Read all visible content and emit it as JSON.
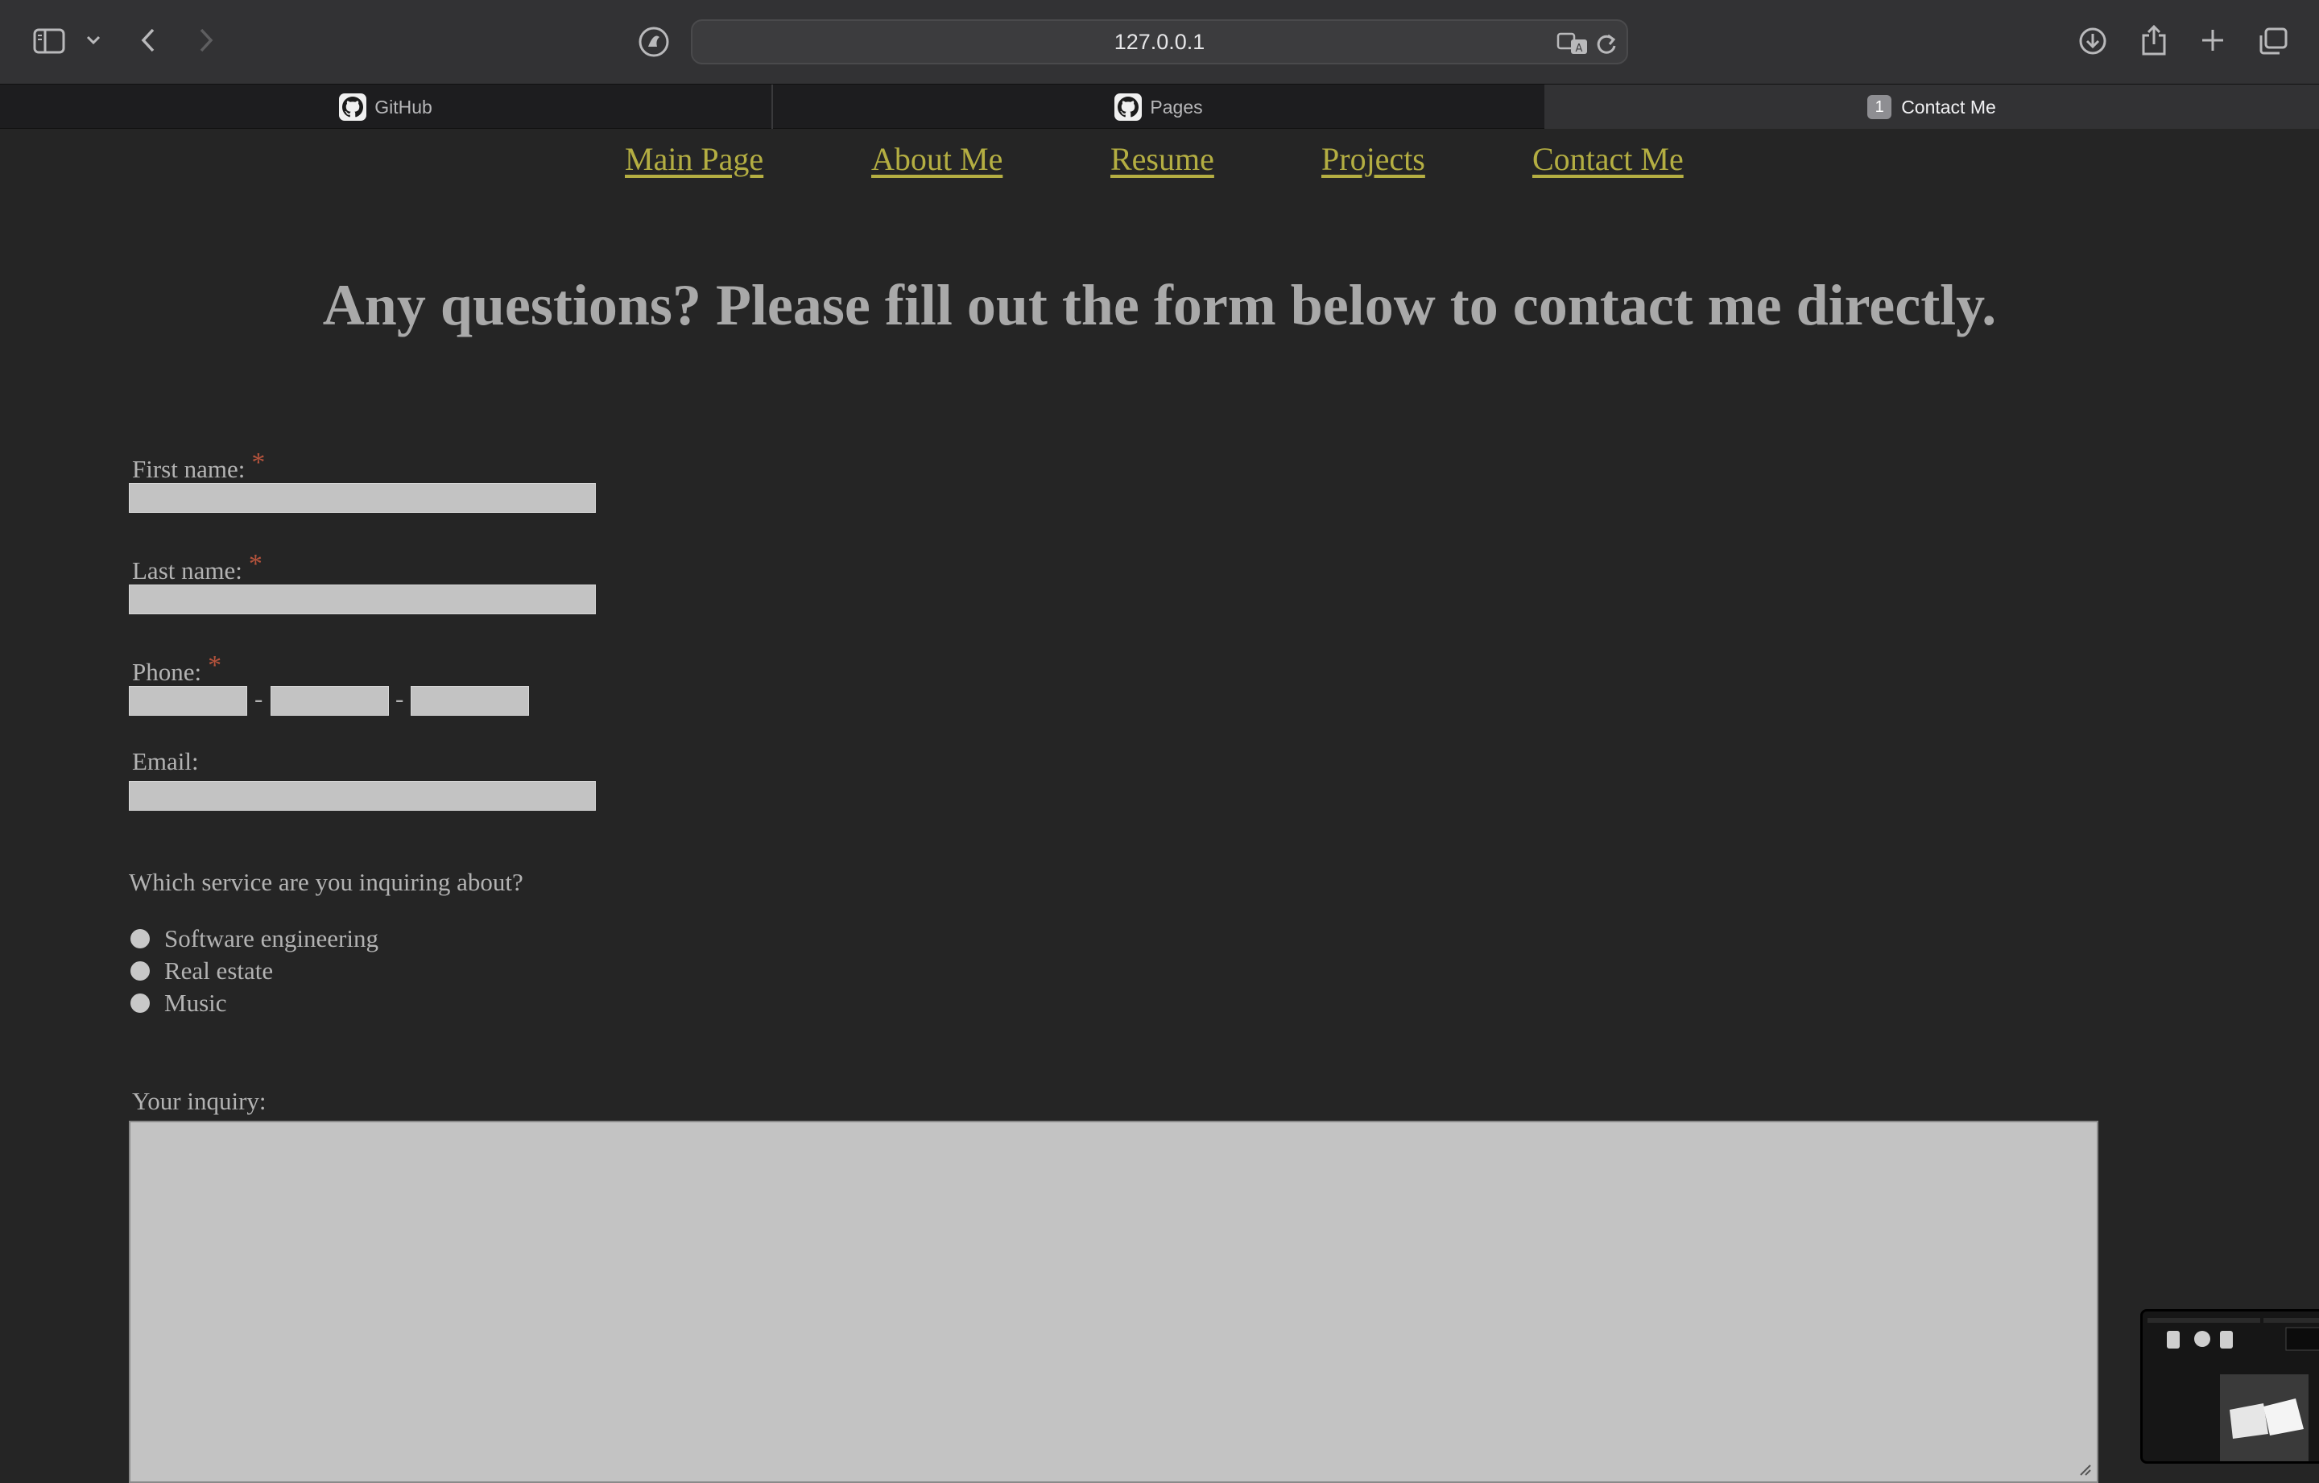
{
  "browser": {
    "url": "127.0.0.1",
    "tabs": [
      {
        "label": "GitHub"
      },
      {
        "label": "Pages"
      },
      {
        "label": "Contact Me",
        "badge": "1"
      }
    ]
  },
  "nav": {
    "links": [
      "Main Page",
      "About Me",
      "Resume",
      "Projects",
      "Contact Me"
    ],
    "link_color": "#b4ae42"
  },
  "main": {
    "heading": "Any questions? Please fill out the form below to contact me directly.",
    "form": {
      "first_name_label": "First name:",
      "last_name_label": "Last name:",
      "phone_label": "Phone:",
      "phone_separator": "-",
      "email_label": "Email:",
      "required_marker": "*",
      "service_question": "Which service are you inquiring about?",
      "services": [
        "Software engineering",
        "Real estate",
        "Music"
      ],
      "inquiry_label": "Your inquiry:"
    }
  },
  "colors": {
    "background": "#252525",
    "field": "#c3c3c3",
    "required": "#b5533c",
    "text": "#b3b3b3"
  },
  "icons": [
    "sidebar-icon",
    "chevron-down-icon",
    "back-icon",
    "forward-icon",
    "privacy-shield-icon",
    "translate-icon",
    "reload-icon",
    "download-icon",
    "share-icon",
    "new-tab-icon",
    "tab-overview-icon",
    "github-icon"
  ]
}
